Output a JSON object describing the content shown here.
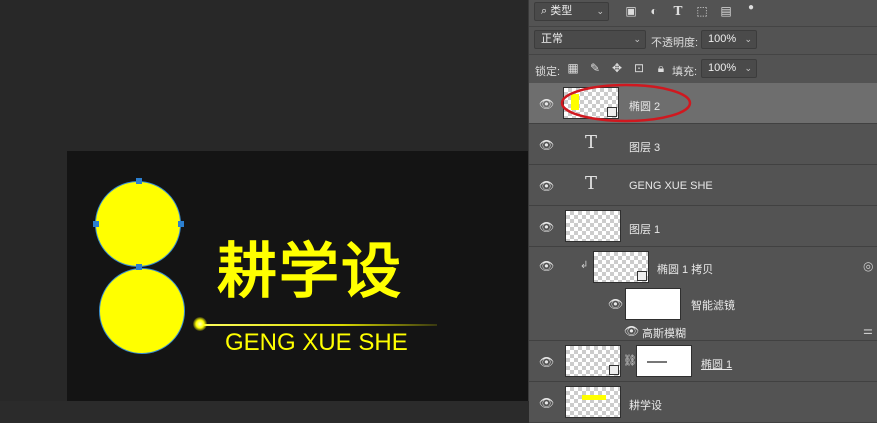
{
  "canvas": {
    "logo_cn": "耕学设",
    "logo_en": "GENG XUE SHE"
  },
  "panel": {
    "filter_kind": "类型",
    "blend_mode": "正常",
    "opacity_label": "不透明度:",
    "opacity_value": "100%",
    "lock_label": "锁定:",
    "fill_label": "填充:",
    "fill_value": "100%"
  },
  "layers": [
    {
      "name": "椭圆 2",
      "selected": true
    },
    {
      "name": "图层 3",
      "type": "text"
    },
    {
      "name": "GENG XUE SHE",
      "type": "text"
    },
    {
      "name": "图层 1"
    },
    {
      "name": "椭圆 1 拷贝"
    },
    {
      "name": "智能滤镜"
    },
    {
      "name": "高斯模糊"
    },
    {
      "name": "椭圆 1"
    },
    {
      "name": "耕学设"
    }
  ],
  "annotation": {
    "color": "#d0181f"
  },
  "colors": {
    "accent": "#ffff00",
    "panel_bg": "#535353",
    "selected_row": "#6e6e6e"
  }
}
